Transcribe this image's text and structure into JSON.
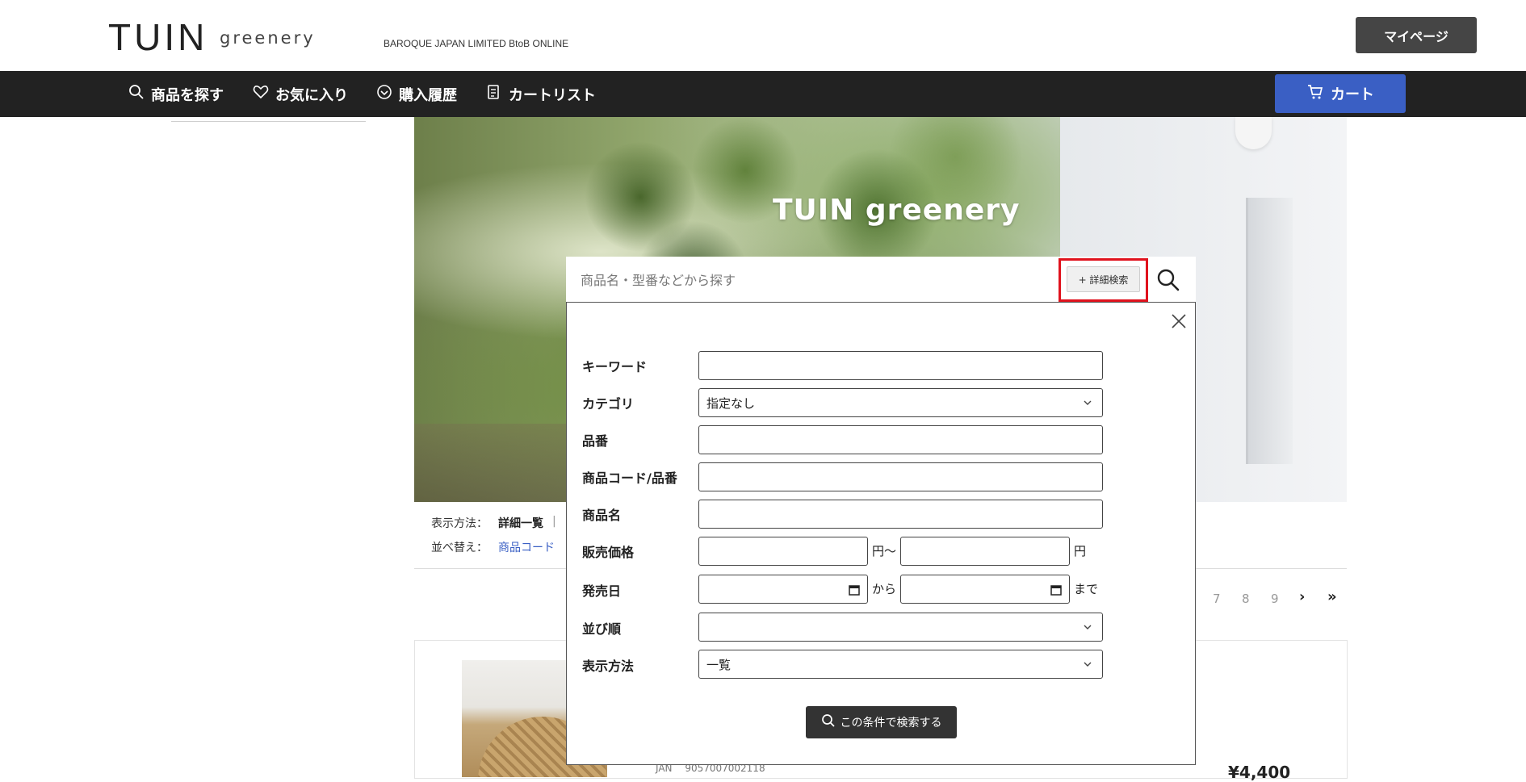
{
  "header": {
    "logo_main": "TUIN",
    "logo_sub": "greenery",
    "tagline": "BAROQUE JAPAN LIMITED BtoB ONLINE",
    "mypage_label": "マイページ"
  },
  "nav": {
    "items": [
      {
        "label": "商品を探す",
        "icon": "search-icon"
      },
      {
        "label": "お気に入り",
        "icon": "heart-icon"
      },
      {
        "label": "購入履歴",
        "icon": "history-icon"
      },
      {
        "label": "カートリスト",
        "icon": "list-icon"
      }
    ],
    "cart_label": "カート"
  },
  "hero": {
    "title": "TUIN greenery"
  },
  "search": {
    "placeholder": "商品名・型番などから探す",
    "advanced_label": "+ 詳細検索"
  },
  "advanced": {
    "fields": {
      "keyword": {
        "label": "キーワード",
        "value": ""
      },
      "category": {
        "label": "カテゴリ",
        "value": "指定なし"
      },
      "item_no": {
        "label": "品番",
        "value": ""
      },
      "product_code": {
        "label": "商品コード/品番",
        "value": ""
      },
      "product_name": {
        "label": "商品名",
        "value": ""
      },
      "price": {
        "label": "販売価格",
        "from_unit": "円〜",
        "to_unit": "円"
      },
      "release_date": {
        "label": "発売日",
        "from_unit": "から",
        "to_unit": "まで"
      },
      "sort": {
        "label": "並び順",
        "value": ""
      },
      "display": {
        "label": "表示方法",
        "value": "一覧"
      }
    },
    "submit_label": "この条件で検索する"
  },
  "listing": {
    "display_label": "表示方法：",
    "display_value": "詳細一覧",
    "display_sep": "|",
    "sort_label": "並べ替え：",
    "sort_value": "商品コード",
    "pages": [
      "7",
      "8",
      "9"
    ],
    "next": "›",
    "last": "»",
    "jan_text": "JAN　 9057007002118",
    "price_text": "¥4,400"
  },
  "colors": {
    "nav_bg": "#222222",
    "cart_blue": "#3a5fc4",
    "highlight_red": "#e0121d",
    "mypage_bg": "#454545"
  }
}
